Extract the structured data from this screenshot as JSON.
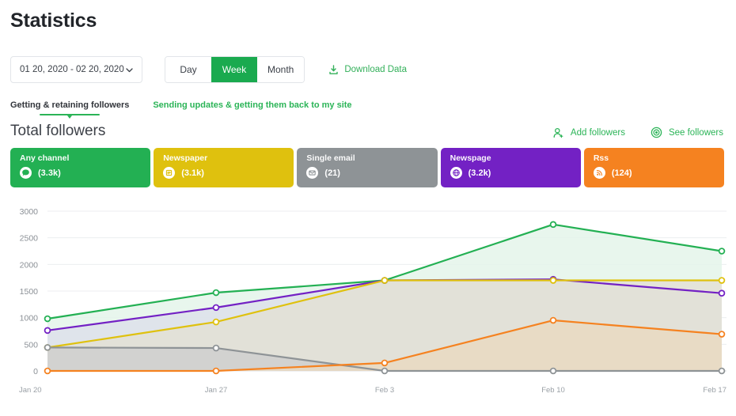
{
  "header": {
    "title": "Statistics"
  },
  "toolbar": {
    "date_range": "01 20, 2020 - 02 20, 2020",
    "chevron_icon": "chevron-down-icon",
    "periods": [
      {
        "label": "Day",
        "active": false
      },
      {
        "label": "Week",
        "active": true
      },
      {
        "label": "Month",
        "active": false
      }
    ],
    "download_label": "Download Data",
    "download_icon": "download-icon"
  },
  "tabs": [
    {
      "label": "Getting & retaining followers",
      "active": true
    },
    {
      "label": "Sending updates & getting them back to my site",
      "active": false
    }
  ],
  "section": {
    "title": "Total followers",
    "actions": [
      {
        "label": "Add followers",
        "icon": "add-user-icon"
      },
      {
        "label": "See followers",
        "icon": "eye-icon"
      }
    ]
  },
  "cards": [
    {
      "label": "Any channel",
      "count": "(3.3k)",
      "color": "#23b053",
      "icon": "chat-bubble-icon"
    },
    {
      "label": "Newspaper",
      "count": "(3.1k)",
      "color": "#dfc10e",
      "icon": "newspaper-icon"
    },
    {
      "label": "Single email",
      "count": "(21)",
      "color": "#8e9396",
      "icon": "envelope-icon"
    },
    {
      "label": "Newspage",
      "count": "(3.2k)",
      "color": "#7321c4",
      "icon": "globe-icon"
    },
    {
      "label": "Rss",
      "count": "(124)",
      "color": "#f58220",
      "icon": "rss-icon"
    }
  ],
  "chart_data": {
    "type": "area",
    "title": "Total followers",
    "xlabel": "",
    "ylabel": "",
    "categories": [
      "Jan 20",
      "Jan 27",
      "Feb 3",
      "Feb 10",
      "Feb 17"
    ],
    "ylim": [
      0,
      3000
    ],
    "yticks": [
      0,
      500,
      1000,
      1500,
      2000,
      2500,
      3000
    ],
    "grid": true,
    "legend_position": "top-cards",
    "series": [
      {
        "name": "Any channel",
        "color": "#23b053",
        "fill": "#e4f5ea",
        "values": [
          980,
          1470,
          1700,
          2750,
          2250
        ]
      },
      {
        "name": "Newspage",
        "color": "#7321c4",
        "fill": "#dde0ea",
        "values": [
          760,
          1190,
          1700,
          1720,
          1460
        ]
      },
      {
        "name": "Newspaper",
        "color": "#dfc10e",
        "fill": "#e3e1d5",
        "values": [
          440,
          920,
          1700,
          1700,
          1700
        ]
      },
      {
        "name": "Single email",
        "color": "#8e9396",
        "fill": "#cfcfcf",
        "values": [
          440,
          430,
          0,
          0,
          0
        ]
      },
      {
        "name": "Rss",
        "color": "#f58220",
        "fill": "#e9d9c2",
        "values": [
          0,
          0,
          150,
          950,
          690
        ]
      }
    ]
  }
}
